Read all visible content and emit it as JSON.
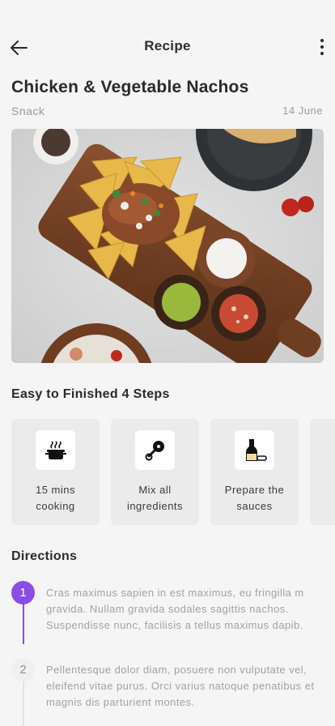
{
  "header": {
    "title": "Recipe",
    "back_icon": "arrow-left-icon",
    "more_icon": "more-vertical-icon"
  },
  "recipe": {
    "title": "Chicken & Vegetable Nachos",
    "category": "Snack",
    "date": "14 June"
  },
  "steps_section": {
    "title": "Easy to Finished 4 Steps",
    "steps": [
      {
        "icon": "cooking-pot-icon",
        "label_line1": "15 mins",
        "label_line2": "cooking"
      },
      {
        "icon": "mixing-spoon-icon",
        "label_line1": "Mix all",
        "label_line2": "ingredients"
      },
      {
        "icon": "sauce-bottle-icon",
        "label_line1": "Prepare the",
        "label_line2": "sauces"
      }
    ]
  },
  "directions": {
    "title": "Directions",
    "items": [
      {
        "number": "1",
        "text": "Cras maximus sapien in est maximus, eu fringilla m gravida. Nullam gravida sodales sagittis nachos. Suspendisse nunc, facilisis a tellus maximus dapib."
      },
      {
        "number": "2",
        "text": "Pellentesque dolor diam, posuere non vulputate vel, eleifend vitae purus. Orci varius natoque penatibus et magnis dis parturient montes."
      }
    ]
  },
  "colors": {
    "accent": "#8a4de6",
    "background": "#f5f5f6",
    "card": "#ebebec"
  }
}
